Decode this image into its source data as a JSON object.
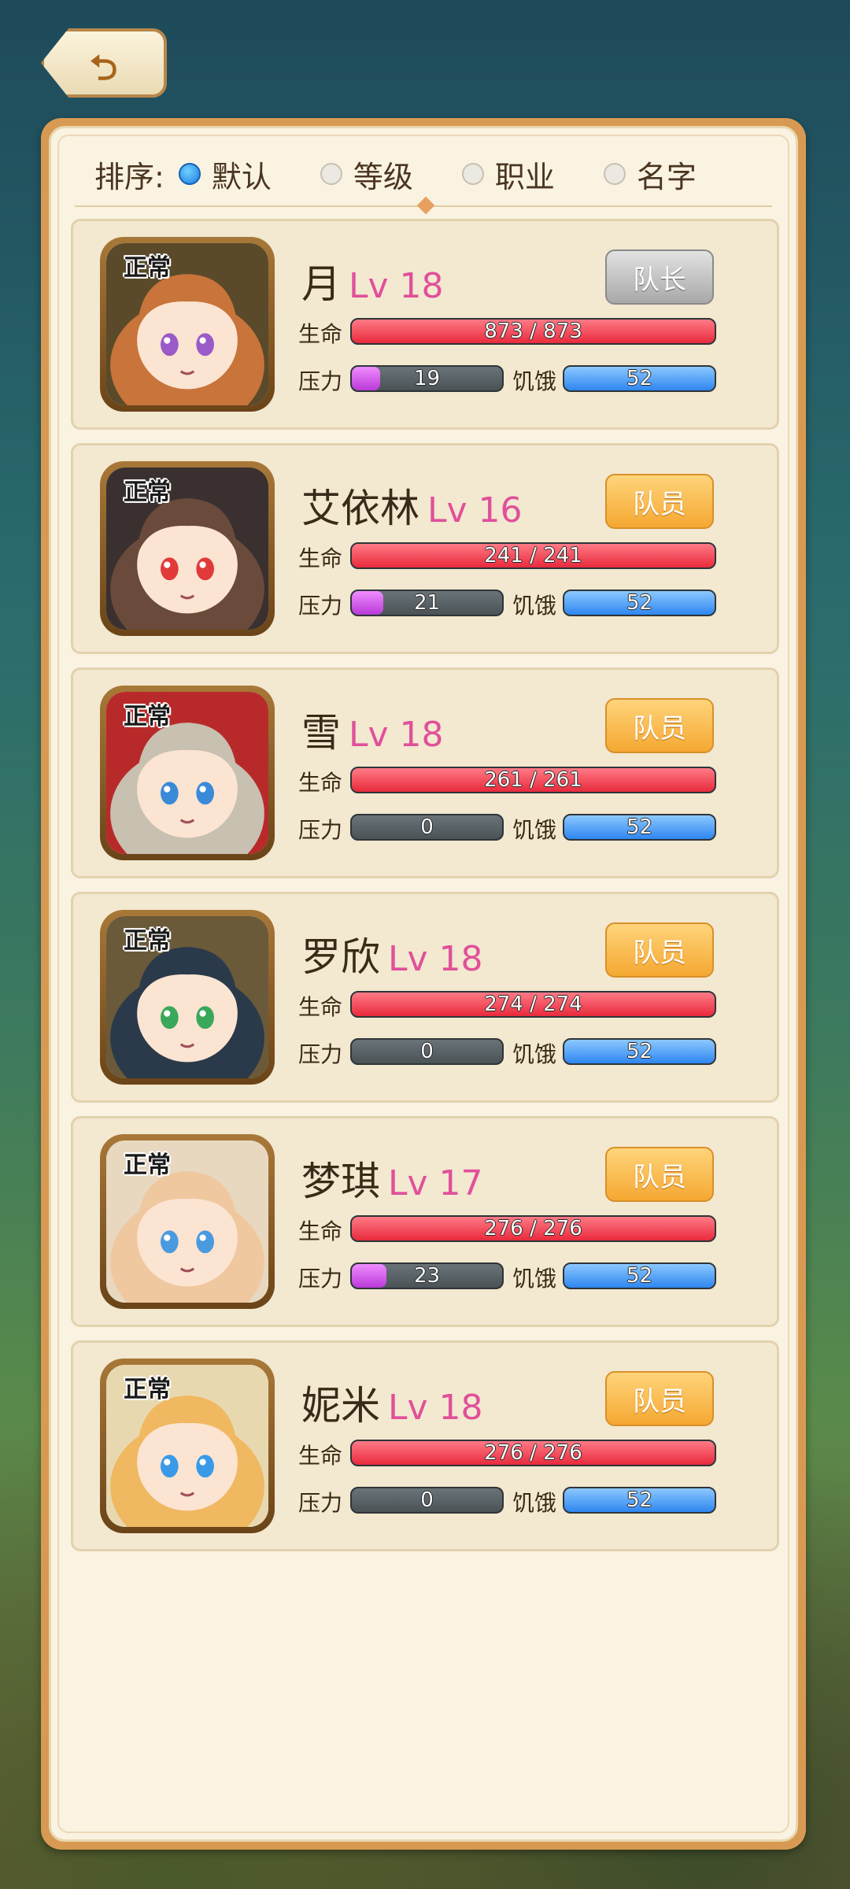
{
  "back_icon": "return-arrow-icon",
  "sort": {
    "label": "排序:",
    "options": [
      {
        "label": "默认",
        "selected": true
      },
      {
        "label": "等级",
        "selected": false
      },
      {
        "label": "职业",
        "selected": false
      },
      {
        "label": "名字",
        "selected": false
      }
    ]
  },
  "colors": {
    "level": "#e0509a",
    "hp": "#e82a3c",
    "stress": "#b83ad8",
    "hunger": "#2e86f0"
  },
  "labels": {
    "hp": "生命",
    "stress": "压力",
    "hunger": "饥饿"
  },
  "characters": [
    {
      "status": "正常",
      "name": "月",
      "level": "Lv 18",
      "role": "队长",
      "role_type": "leader",
      "hp": "873 / 873",
      "hp_pct": 100,
      "stress": "19",
      "stress_pct": 19,
      "hunger": "52",
      "hunger_pct": 100
    },
    {
      "status": "正常",
      "name": "艾依林",
      "level": "Lv 16",
      "role": "队员",
      "role_type": "member",
      "hp": "241 / 241",
      "hp_pct": 100,
      "stress": "21",
      "stress_pct": 21,
      "hunger": "52",
      "hunger_pct": 100
    },
    {
      "status": "正常",
      "name": "雪",
      "level": "Lv 18",
      "role": "队员",
      "role_type": "member",
      "hp": "261 / 261",
      "hp_pct": 100,
      "stress": "0",
      "stress_pct": 0,
      "hunger": "52",
      "hunger_pct": 100
    },
    {
      "status": "正常",
      "name": "罗欣",
      "level": "Lv 18",
      "role": "队员",
      "role_type": "member",
      "hp": "274 / 274",
      "hp_pct": 100,
      "stress": "0",
      "stress_pct": 0,
      "hunger": "52",
      "hunger_pct": 100
    },
    {
      "status": "正常",
      "name": "梦琪",
      "level": "Lv 17",
      "role": "队员",
      "role_type": "member",
      "hp": "276 / 276",
      "hp_pct": 100,
      "stress": "23",
      "stress_pct": 23,
      "hunger": "52",
      "hunger_pct": 100
    },
    {
      "status": "正常",
      "name": "妮米",
      "level": "Lv 18",
      "role": "队员",
      "role_type": "member",
      "hp": "276 / 276",
      "hp_pct": 100,
      "stress": "0",
      "stress_pct": 0,
      "hunger": "52",
      "hunger_pct": 100
    }
  ]
}
